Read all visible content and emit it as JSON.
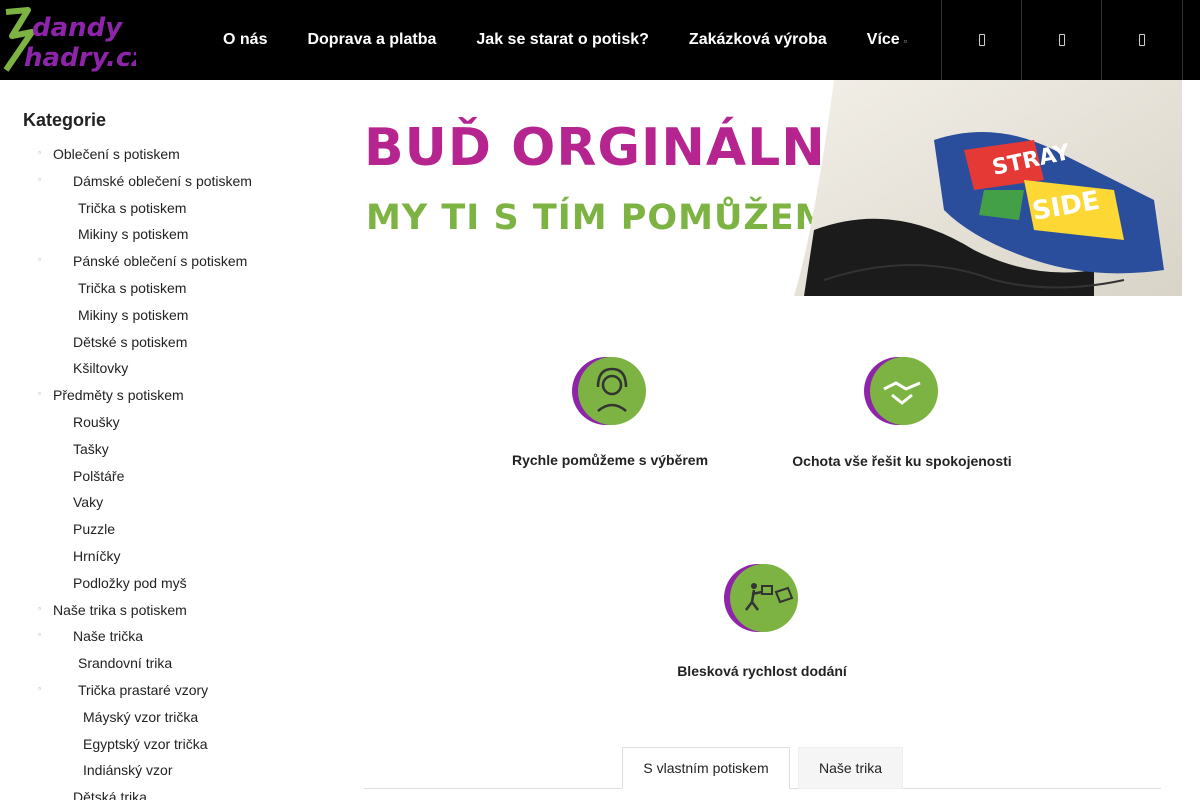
{
  "header": {
    "logo_text_line1": "dandy",
    "logo_text_line2": "hadry.cz",
    "nav": [
      {
        "label": "O nás"
      },
      {
        "label": "Doprava a platba"
      },
      {
        "label": "Jak se starat o potisk?"
      },
      {
        "label": "Zakázková výroba"
      },
      {
        "label": "Více",
        "caret": "▫"
      }
    ],
    "icons": [
      "search-icon",
      "user-icon",
      "cart-icon"
    ]
  },
  "sidebar": {
    "title": "Kategorie",
    "items": [
      {
        "label": "Oblečení s potiskem",
        "bullet": "▫"
      },
      {
        "label": "Dámské oblečení s potiskem",
        "bullet": "▫"
      },
      {
        "label": "Trička s potiskem"
      },
      {
        "label": "Mikiny s potiskem"
      },
      {
        "label": "Pánské oblečení s potiskem",
        "bullet": "▫"
      },
      {
        "label": "Trička s potiskem"
      },
      {
        "label": "Mikiny s potiskem"
      },
      {
        "label": "Dětské s potiskem"
      },
      {
        "label": "Kšiltovky"
      },
      {
        "label": "Předměty s potiskem",
        "bullet": "▫"
      },
      {
        "label": "Roušky"
      },
      {
        "label": "Tašky"
      },
      {
        "label": "Polštáře"
      },
      {
        "label": "Vaky"
      },
      {
        "label": "Puzzle"
      },
      {
        "label": "Hrníčky"
      },
      {
        "label": "Podložky pod myš"
      },
      {
        "label": "Naše trika s potiskem",
        "bullet": "▫"
      },
      {
        "label": "Naše trička",
        "bullet": "▫"
      },
      {
        "label": "Srandovní trika"
      },
      {
        "label": "Trička prastaré vzory",
        "bullet": "▫"
      },
      {
        "label": "Máyský vzor trička"
      },
      {
        "label": "Egyptský vzor trička"
      },
      {
        "label": "Indiánský vzor"
      },
      {
        "label": "Dětská trika"
      }
    ]
  },
  "banner": {
    "line1": "BUĎ ORGINÁLNÍ!",
    "line2": "MY TI S TÍM POMŮŽEME."
  },
  "features": [
    {
      "text": "Rychle pomůžeme s výběrem",
      "icon": "headset-icon"
    },
    {
      "text": "Ochota vše řešit ku spokojenosti",
      "icon": "handshake-icon"
    },
    {
      "text": "Blesková rychlost dodání",
      "icon": "delivery-icon"
    }
  ],
  "tabs": [
    {
      "label": "S vlastním potiskem",
      "active": true
    },
    {
      "label": "Naše trika",
      "active": false
    }
  ],
  "colors": {
    "brand_green": "#7cb342",
    "brand_purple": "#8e24aa",
    "banner_pink": "#b5248f",
    "header_bg": "#000000"
  }
}
